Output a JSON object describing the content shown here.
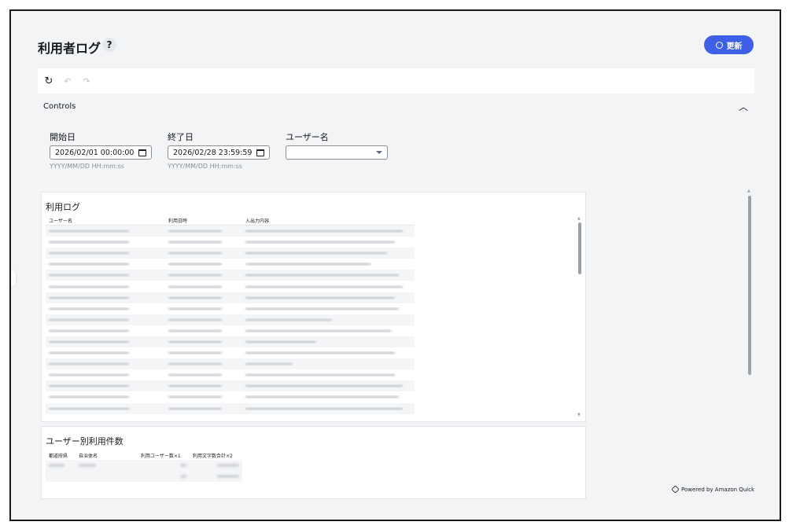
{
  "header": {
    "title": "利用者ログ",
    "help_label": "?",
    "refresh_label": "更新"
  },
  "toolbar": {
    "reset_icon": "reset-icon",
    "undo_icon": "undo-icon",
    "redo_icon": "redo-icon"
  },
  "controls": {
    "title": "Controls",
    "start_date": {
      "label": "開始日",
      "value": "2026/02/01 00:00:00",
      "hint": "YYYY/MM/DD HH:mm:ss"
    },
    "end_date": {
      "label": "終了日",
      "value": "2026/02/28 23:59:59",
      "hint": "YYYY/MM/DD HH:mm:ss"
    },
    "user_name": {
      "label": "ユーザー名",
      "value": ""
    }
  },
  "log_panel": {
    "title": "利用ログ",
    "columns": [
      "ユーザー名",
      "利用日時",
      "入出力内容"
    ],
    "row_count": 17
  },
  "summary_panel": {
    "title": "ユーザー別利用件数",
    "columns": [
      "都道府県",
      "自治体名",
      "利用ユーザー数×1",
      "利用文字数合計×2"
    ],
    "row_count": 2
  },
  "footer": {
    "powered_by": "Powered by Amazon Quick"
  },
  "colors": {
    "accent": "#3f5fe6",
    "background": "#f2f4f6"
  }
}
